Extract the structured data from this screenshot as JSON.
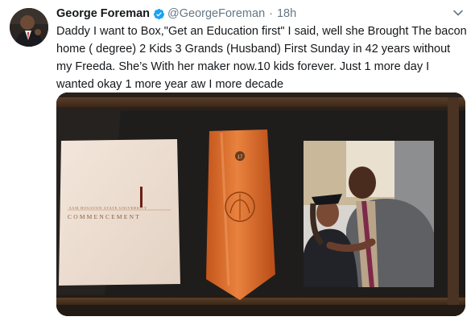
{
  "tweet": {
    "author_name": "George Foreman",
    "handle": "@GeorgeForeman",
    "separator": "·",
    "time": "18h",
    "text": "Daddy I want to Box,\"Get an Education first\" I said, well she Brought The bacon home ( degree) 2 Kids 3 Grands (Husband) First Sunday in 42 years without my Freeda. She’s With her maker now.10 kids forever. Just 1 more day I wanted okay 1 more year aw I more decade"
  },
  "photo": {
    "program_text": "SAM HOUSTON STATE UNIVERSITY",
    "commencement_text": "COMMENCEMENT",
    "stole_emblem": "17"
  },
  "colors": {
    "verified_blue": "#1da1f2",
    "text_dark": "#14171a",
    "text_gray": "#657786",
    "stole_orange": "#d9692a"
  },
  "icons": {
    "verified": "verified-badge-icon",
    "caret": "chevron-down-icon"
  }
}
